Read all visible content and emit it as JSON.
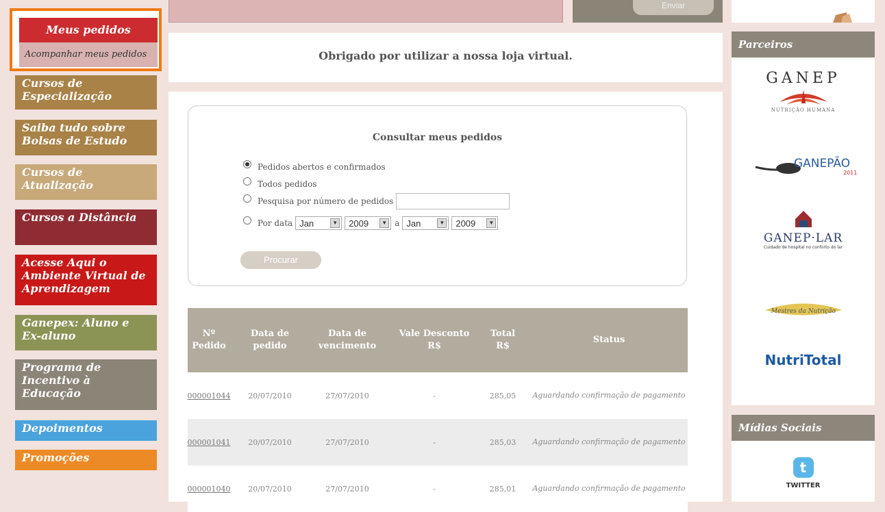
{
  "sidebar": {
    "active_title": "Meus pedidos",
    "active_sub": "Acompanhar meus pedidos",
    "items": [
      {
        "label": "Cursos de Especialização",
        "color": "#a88247"
      },
      {
        "label": "Saiba tudo sobre Bolsas de Estudo",
        "color": "#a88247"
      },
      {
        "label": "Cursos de Atualização",
        "color": "#c7a97a"
      },
      {
        "label": "Cursos a Distância",
        "color": "#8f2c33"
      },
      {
        "label": "Acesse Aqui o Ambiente Virtual de Aprendizagem",
        "color": "#c81818"
      },
      {
        "label": "Ganepex: Aluno e Ex-aluno",
        "color": "#8c9455"
      },
      {
        "label": "Programa de Incentivo à Educação",
        "color": "#8a8577"
      },
      {
        "label": "Depoimentos",
        "color": "#4aa3dc"
      },
      {
        "label": "Promoções",
        "color": "#ec8a25"
      }
    ]
  },
  "top": {
    "button_label": "Enviar"
  },
  "thanks": "Obrigado por utilizar a nossa loja virtual.",
  "search": {
    "title": "Consultar meus pedidos",
    "options": [
      "Pedidos abertos e confirmados",
      "Todos pedidos",
      "Pesquisa por número de pedidos",
      "Por data"
    ],
    "selected_option": 0,
    "date_from_month": "Jan",
    "date_from_year": "2009",
    "date_separator": "a",
    "date_to_month": "Jan",
    "date_to_year": "2009",
    "button": "Procurar"
  },
  "table": {
    "headers": {
      "num": "Nº Pedido",
      "date": "Data de pedido",
      "due": "Data de vencimento",
      "discount": "Vale Desconto R$",
      "total": "Total R$",
      "status": "Status"
    },
    "rows": [
      {
        "num": "000001044",
        "date": "20/07/2010",
        "due": "27/07/2010",
        "discount": "-",
        "total": "285,05",
        "status": "Aguardando confirmação de pagamento"
      },
      {
        "num": "000001041",
        "date": "20/07/2010",
        "due": "27/07/2010",
        "discount": "-",
        "total": "285,03",
        "status": "Aguardando confirmação de pagamento"
      },
      {
        "num": "000001040",
        "date": "20/07/2010",
        "due": "27/07/2010",
        "discount": "-",
        "total": "285,01",
        "status": "Aguardando confirmação de pagamento"
      }
    ]
  },
  "right": {
    "parceiros_title": "Parceiros",
    "midias_title": "Mídias Sociais",
    "partners": [
      "GANEP",
      "GANEPÃO",
      "GANEP·LAR",
      "Mestres da Nutrição",
      "NutriTotal"
    ],
    "ganep_sub": "NUTRIÇÃO HUMANA",
    "ganepao_year": "2011",
    "ganeplar_sub": "Cuidado de hospital no conforto do lar",
    "twitter": "TWITTER"
  }
}
